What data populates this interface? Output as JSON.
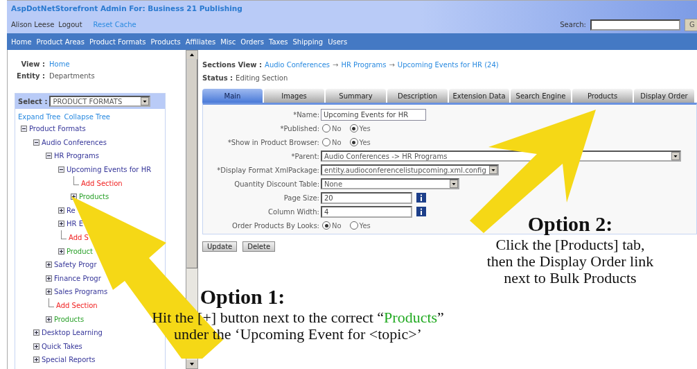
{
  "header": {
    "title": "AspDotNetStorefront Admin For: Business 21 Publishing",
    "user": "Alison Leese",
    "logout": "Logout",
    "reset": "Reset Cache",
    "search_label": "Search:",
    "search_button": "G"
  },
  "nav": [
    "Home",
    "Product Areas",
    "Product Formats",
    "Products",
    "Affiliates",
    "Misc",
    "Orders",
    "Taxes",
    "Shipping",
    "Users"
  ],
  "sidebar": {
    "view_label": "View :",
    "view_value": "Home",
    "entity_label": "Entity :",
    "entity_value": "Departments",
    "select_label": "Select :",
    "select_value": "PRODUCT FORMATS",
    "expand": "Expand Tree",
    "collapse": "Collapse Tree",
    "tree": [
      {
        "kind": "section",
        "label": "Product Formats",
        "expanded": true,
        "children": [
          {
            "kind": "section",
            "label": "Audio Conferences",
            "expanded": true,
            "children": [
              {
                "kind": "section",
                "label": "HR Programs",
                "expanded": true,
                "children": [
                  {
                    "kind": "section",
                    "label": "Upcoming Events for HR",
                    "expanded": true,
                    "children": [
                      {
                        "kind": "add",
                        "label": "Add Section"
                      },
                      {
                        "kind": "products",
                        "label": "Products",
                        "expanded": false
                      }
                    ]
                  },
                  {
                    "kind": "section",
                    "label": "Re",
                    "expanded": false
                  },
                  {
                    "kind": "section",
                    "label": "HR E",
                    "expanded": false
                  },
                  {
                    "kind": "add",
                    "label": "Add S"
                  },
                  {
                    "kind": "products",
                    "label": "Product",
                    "expanded": false
                  }
                ]
              },
              {
                "kind": "section",
                "label": "Safety Progr",
                "expanded": false
              },
              {
                "kind": "section",
                "label": "Finance Progr",
                "expanded": false
              },
              {
                "kind": "section",
                "label": "Sales Programs",
                "expanded": false
              },
              {
                "kind": "add",
                "label": "Add Section"
              },
              {
                "kind": "products",
                "label": "Products",
                "expanded": false
              }
            ]
          },
          {
            "kind": "section",
            "label": "Desktop Learning",
            "expanded": false
          },
          {
            "kind": "section",
            "label": "Quick Takes",
            "expanded": false
          },
          {
            "kind": "section",
            "label": "Special Reports",
            "expanded": false
          }
        ]
      }
    ]
  },
  "main": {
    "view_label": "Sections View :",
    "breadcrumb": [
      "Audio Conferences",
      "HR Programs",
      "Upcoming Events for HR (24)"
    ],
    "crumb_sep": "→",
    "status_label": "Status :",
    "status_value": "Editing Section",
    "tabs": [
      {
        "label": "Main",
        "selected": true
      },
      {
        "label": "Images",
        "selected": false
      },
      {
        "label": "Summary",
        "selected": false
      },
      {
        "label": "Description",
        "selected": false
      },
      {
        "label": "Extension Data",
        "selected": false
      },
      {
        "label": "Search Engine",
        "selected": false
      },
      {
        "label": "Products",
        "selected": false
      },
      {
        "label": "Display Order",
        "selected": false
      }
    ],
    "fields": [
      {
        "kind": "text",
        "label": "*Name:",
        "value": "Upcoming Events for HR"
      },
      {
        "kind": "radio",
        "label": "*Published:",
        "options": [
          {
            "label": "No",
            "selected": false
          },
          {
            "label": "Yes",
            "selected": true
          }
        ]
      },
      {
        "kind": "radio",
        "label": "*Show in Product Browser:",
        "options": [
          {
            "label": "No",
            "selected": false
          },
          {
            "label": "Yes",
            "selected": true
          }
        ]
      },
      {
        "kind": "wideselect",
        "label": "*Parent:",
        "value": "Audio Conferences -> HR Programs"
      },
      {
        "kind": "select",
        "label": "*Display Format XmlPackage:",
        "value": "entity.audioconferencelistupcoming.xml.config"
      },
      {
        "kind": "select",
        "label": "Quantity Discount Table:",
        "value": "None"
      },
      {
        "kind": "info",
        "label": "Page Size:",
        "value": "20"
      },
      {
        "kind": "info",
        "label": "Column Width:",
        "value": "4"
      },
      {
        "kind": "radio",
        "label": "Order Products By Looks:",
        "options": [
          {
            "label": "No",
            "selected": true
          },
          {
            "label": "Yes",
            "selected": false
          }
        ]
      }
    ],
    "buttons": [
      "Update",
      "Delete"
    ]
  },
  "annotations": [
    {
      "title": "Option 1:",
      "lines": [
        {
          "before": "Hit the [+] button next to the correct “",
          "highlight": "Products",
          "after": "”"
        },
        {
          "before": "under the ‘Upcoming Event for <topic>’"
        }
      ]
    },
    {
      "title": "Option 2:",
      "lines": [
        {
          "before": "Click the [Products] tab,"
        },
        {
          "before": "then the Display Order link"
        },
        {
          "before": "next to Bulk Products"
        }
      ]
    }
  ]
}
